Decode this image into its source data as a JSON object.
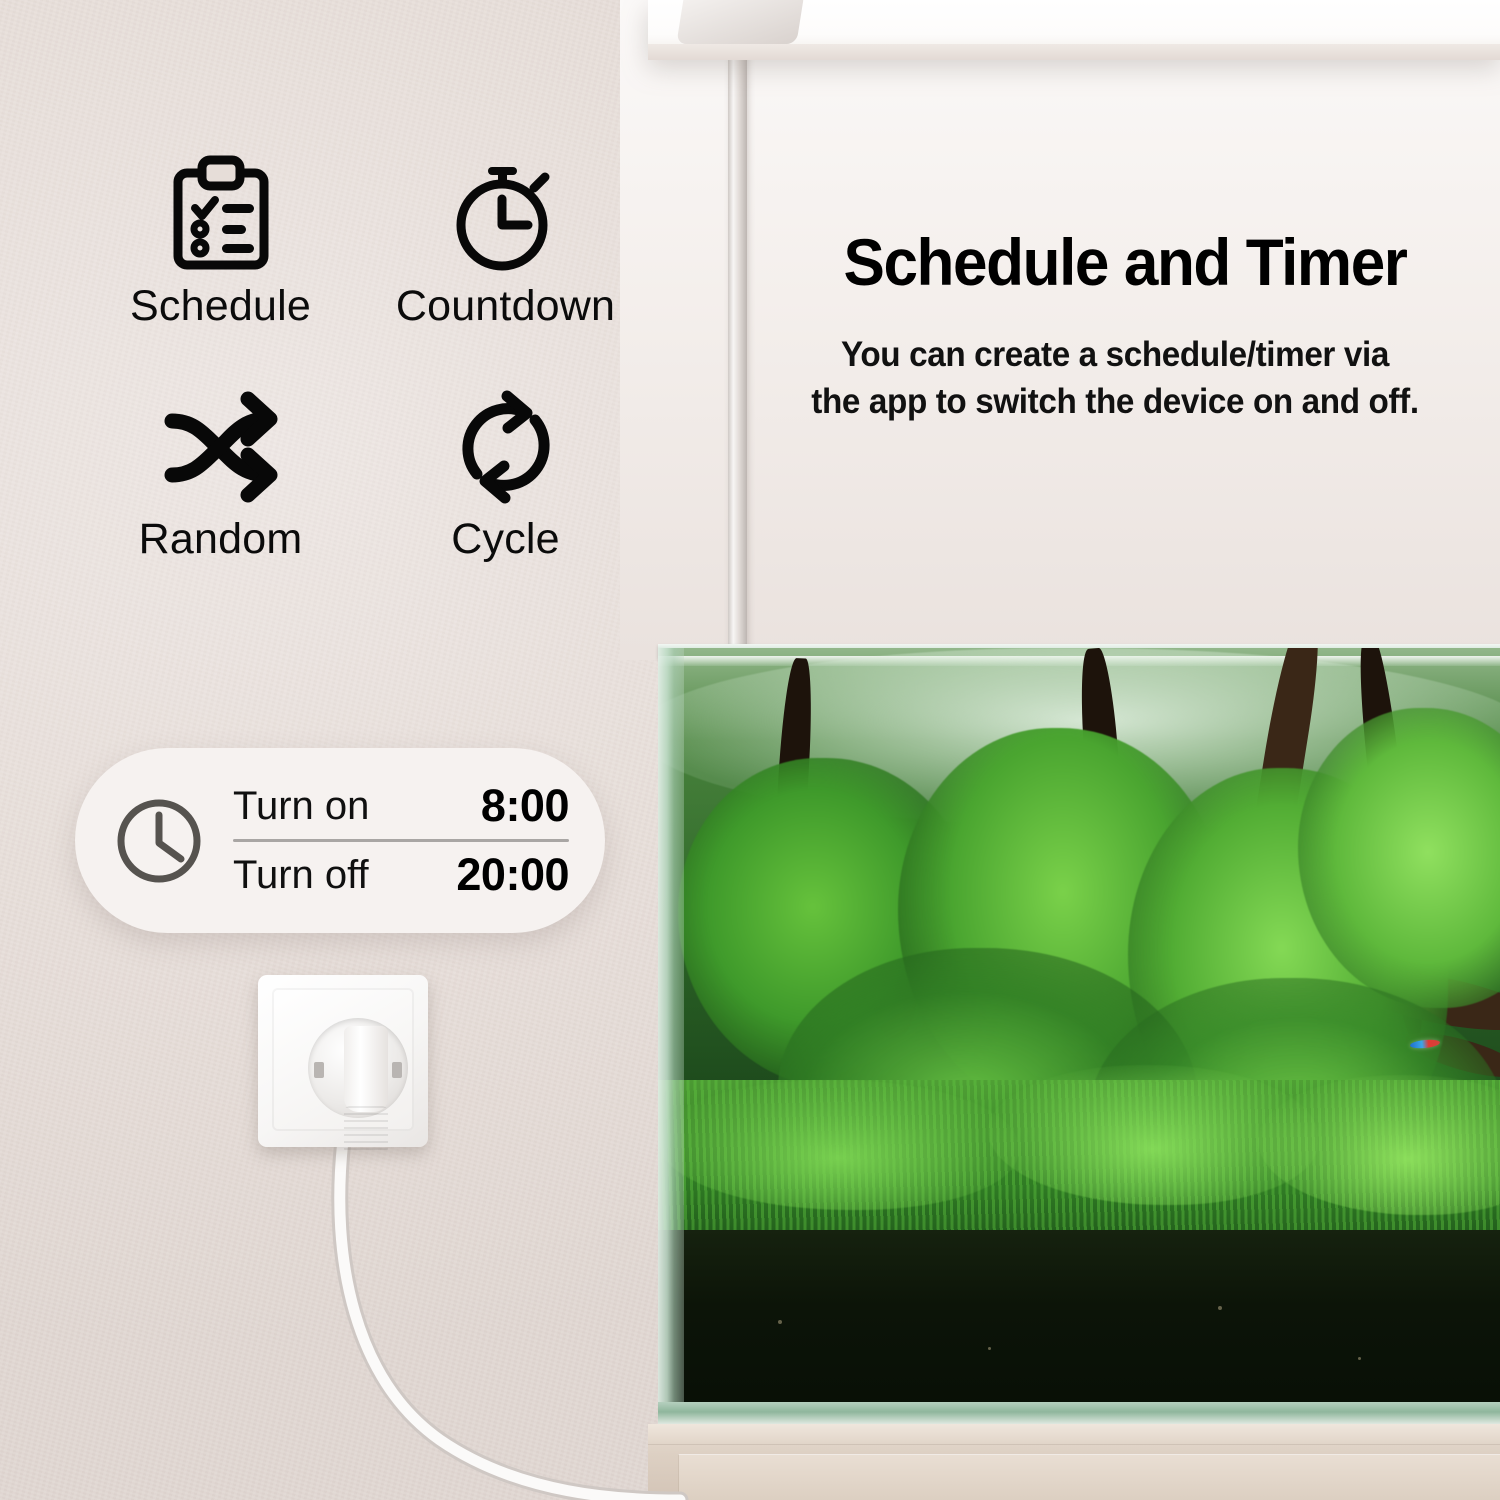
{
  "background": {
    "wall_color": "#e6ddd8",
    "accent_white": "#ffffff"
  },
  "features": {
    "items": [
      {
        "label": "Schedule",
        "icon": "clipboard-checklist-icon"
      },
      {
        "label": "Countdown",
        "icon": "stopwatch-icon"
      },
      {
        "label": "Random",
        "icon": "shuffle-icon"
      },
      {
        "label": "Cycle",
        "icon": "cycle-refresh-icon"
      }
    ]
  },
  "headline": {
    "title": "Schedule and Timer",
    "subtitle_line1": "You can create a schedule/timer via",
    "subtitle_line2": "the app to switch the device on and off."
  },
  "schedule_card": {
    "clock_icon": "clock-icon",
    "rows": [
      {
        "label": "Turn on",
        "value": "8:00"
      },
      {
        "label": "Turn off",
        "value": "20:00"
      }
    ]
  },
  "scene": {
    "socket": "wall-power-socket",
    "plug": "power-plug",
    "cable": "power-cable",
    "aquarium": "planted-aquarium",
    "light_fixture": "aquarium-led-light",
    "cabinet": "aquarium-cabinet"
  }
}
